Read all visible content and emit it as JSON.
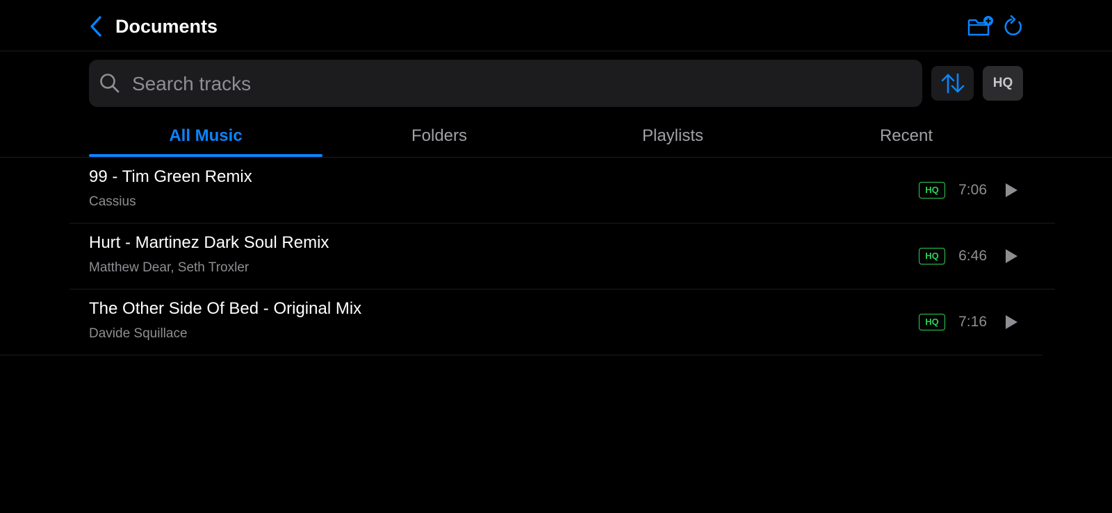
{
  "header": {
    "title": "Documents"
  },
  "search": {
    "placeholder": "Search tracks",
    "value": ""
  },
  "toolbar": {
    "hq_label": "HQ"
  },
  "tabs": [
    {
      "label": "All Music",
      "active": true
    },
    {
      "label": "Folders",
      "active": false
    },
    {
      "label": "Playlists",
      "active": false
    },
    {
      "label": "Recent",
      "active": false
    }
  ],
  "tracks": [
    {
      "title": "99 - Tim Green Remix",
      "artist": "Cassius",
      "quality": "HQ",
      "duration": "7:06"
    },
    {
      "title": "Hurt - Martinez Dark Soul Remix",
      "artist": "Matthew Dear, Seth Troxler",
      "quality": "HQ",
      "duration": "6:46"
    },
    {
      "title": "The Other Side Of Bed - Original Mix",
      "artist": "Davide Squillace",
      "quality": "HQ",
      "duration": "7:16"
    }
  ],
  "icons": {
    "back": "chevron-left-icon",
    "folder_add": "folder-add-icon",
    "refresh": "refresh-icon",
    "search": "search-icon",
    "sort": "sort-icon",
    "play": "play-icon"
  },
  "colors": {
    "accent": "#0a84ff",
    "hq_badge": "#30d158",
    "background": "#000000",
    "surface": "#1c1c1e"
  }
}
